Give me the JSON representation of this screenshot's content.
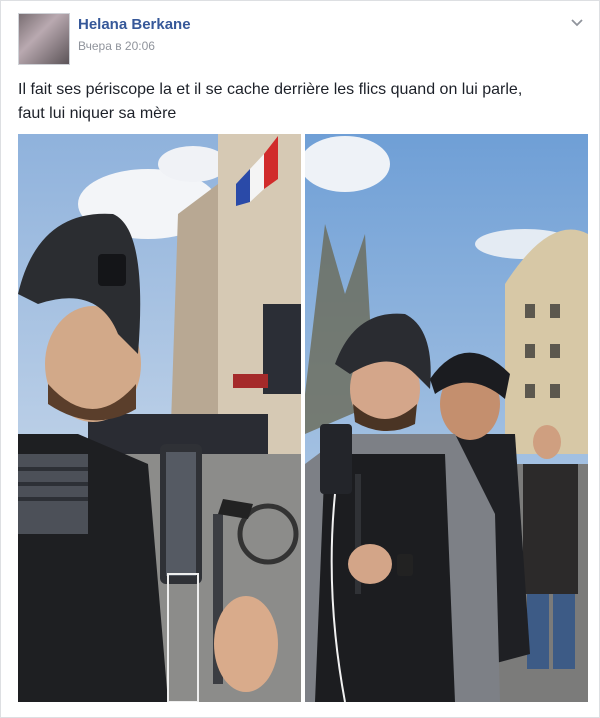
{
  "post": {
    "author": "Helana Berkane",
    "timestamp": "Вчера в 20:06",
    "text_line1": "Il fait ses périscope la et il se cache derrière les flics quand on lui parle,",
    "text_line2": "faut lui niquer sa mère"
  },
  "icons": {
    "menu": "chevron-down-icon"
  },
  "colors": {
    "author_link": "#365899",
    "text": "#1d2129",
    "meta": "#90949c"
  }
}
